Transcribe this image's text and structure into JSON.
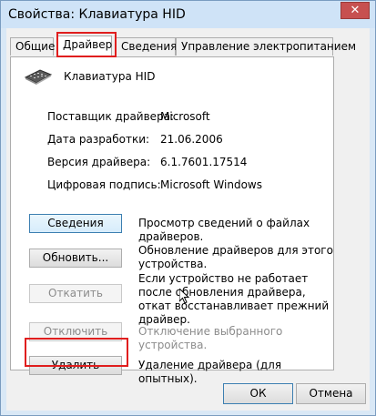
{
  "window": {
    "title": "Свойства: Клавиатура HID",
    "close_glyph": "✕"
  },
  "tabs": [
    {
      "label": "Общие"
    },
    {
      "label": "Драйвер"
    },
    {
      "label": "Сведения"
    },
    {
      "label": "Управление электропитанием"
    }
  ],
  "active_tab": "Драйвер",
  "device": {
    "name": "Клавиатура HID",
    "icon": "keyboard-icon"
  },
  "properties": [
    {
      "label": "Поставщик драйвера:",
      "value": "Microsoft"
    },
    {
      "label": "Дата разработки:",
      "value": "21.06.2006"
    },
    {
      "label": "Версия драйвера:",
      "value": "6.1.7601.17514"
    },
    {
      "label": "Цифровая подпись:",
      "value": "Microsoft Windows"
    }
  ],
  "actions": [
    {
      "button": "Сведения",
      "description": "Просмотр сведений о файлах драйверов.",
      "enabled": true
    },
    {
      "button": "Обновить...",
      "description": "Обновление драйверов для этого устройства.",
      "enabled": true
    },
    {
      "button": "Откатить",
      "description": "Если устройство не работает после обновления драйвера, откат восстанавливает прежний драйвер.",
      "enabled": false
    },
    {
      "button": "Отключить",
      "description": "Отключение выбранного устройства.",
      "enabled": false
    },
    {
      "button": "Удалить",
      "description": "Удаление драйвера (для опытных).",
      "enabled": true
    }
  ],
  "footer": {
    "ok": "ОК",
    "cancel": "Отмена"
  },
  "colors": {
    "highlight": "#e01e1e",
    "window_frame": "#cfe3f7",
    "disabled_text": "#8c8c8c"
  }
}
